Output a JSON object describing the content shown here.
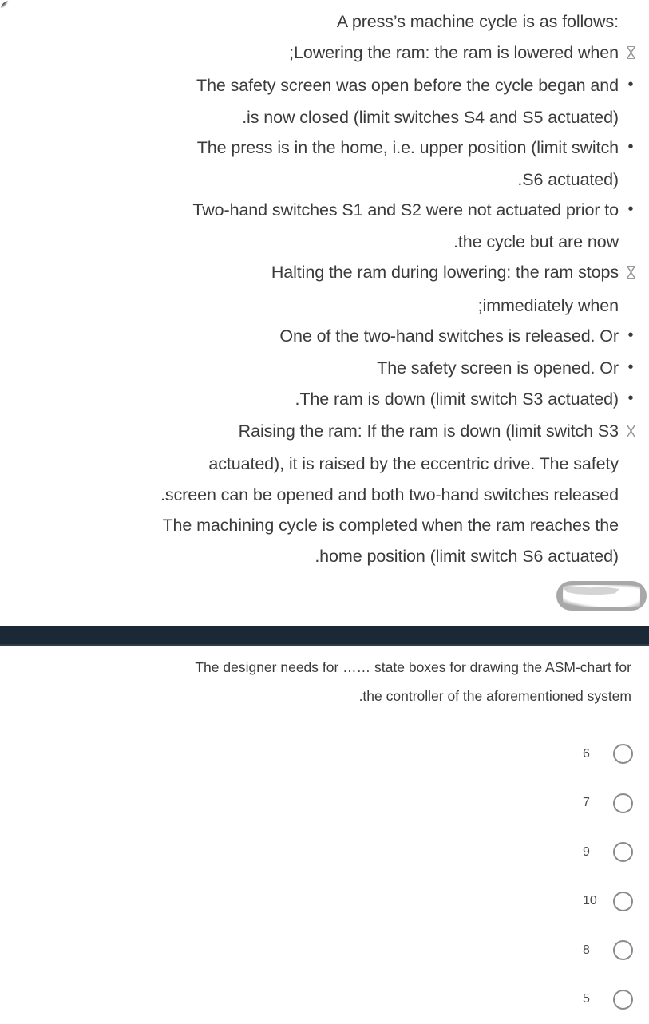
{
  "colors": {
    "page_background": "#ffffff",
    "text": "#3b3b3b",
    "dark_band": "#1b2936",
    "radio_border": "#8a8a8a",
    "redaction_gray": "#a8a8a8"
  },
  "stem": {
    "lines": [
      {
        "marker": "none",
        "text": "A press’s machine cycle is as follows:"
      },
      {
        "marker": "tofu",
        "text": ";Lowering the ram: the ram is lowered when"
      },
      {
        "marker": "dot",
        "text": "The safety screen was open before the cycle began and"
      },
      {
        "marker": "none",
        "text": ".is now closed (limit switches S4 and S5 actuated)"
      },
      {
        "marker": "dot",
        "text": "The press is in the home, i.e. upper position (limit switch"
      },
      {
        "marker": "none",
        "text": ".S6 actuated)"
      },
      {
        "marker": "dot",
        "text": "Two-hand switches S1 and S2 were not actuated prior to"
      },
      {
        "marker": "none",
        "text": ".the cycle but are now"
      },
      {
        "marker": "tofu",
        "text": "Halting the ram during lowering: the ram stops"
      },
      {
        "marker": "none",
        "text": ";immediately when"
      },
      {
        "marker": "dot",
        "text": "One of the two-hand switches is released. Or"
      },
      {
        "marker": "dot",
        "text": "The safety screen is opened. Or"
      },
      {
        "marker": "dot",
        "text": ".The ram is down (limit switch S3 actuated)"
      },
      {
        "marker": "tofu",
        "text": "Raising the ram: If the ram is down (limit switch S3"
      },
      {
        "marker": "none",
        "text": "actuated), it is raised by the eccentric drive. The safety"
      },
      {
        "marker": "none",
        "text": ".screen can be opened and both two-hand switches released"
      },
      {
        "marker": "none",
        "text": "The machining cycle is completed when the ram reaches the"
      },
      {
        "marker": "none",
        "text": ".home position (limit switch S6 actuated)"
      }
    ],
    "truncated_tail": ")"
  },
  "redaction": {
    "label": "scribbled-out-badge"
  },
  "dark_band": {
    "ghost_text": ""
  },
  "question": {
    "lines": [
      "The designer needs for …… state boxes for drawing the ASM-chart for",
      ".the controller of the aforementioned system"
    ],
    "options": [
      {
        "label": "6",
        "selected": false
      },
      {
        "label": "7",
        "selected": false
      },
      {
        "label": "9",
        "selected": false
      },
      {
        "label": "10",
        "selected": false
      },
      {
        "label": "8",
        "selected": false
      },
      {
        "label": "5",
        "selected": false
      }
    ]
  }
}
